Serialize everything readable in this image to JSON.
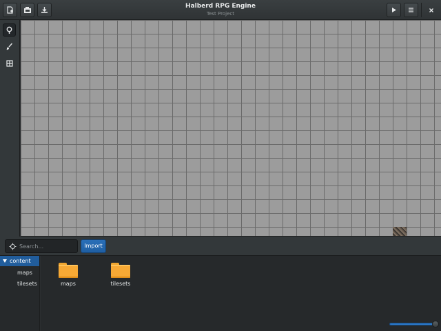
{
  "header": {
    "title": "Halberd RPG Engine",
    "subtitle": "Test Project",
    "left_buttons": [
      {
        "icon": "new-document-icon"
      },
      {
        "icon": "open-icon"
      },
      {
        "icon": "download-icon"
      }
    ],
    "right_buttons": [
      {
        "icon": "play-icon"
      },
      {
        "icon": "menu-icon"
      },
      {
        "icon": "close-icon"
      }
    ]
  },
  "tools": [
    {
      "icon": "pin-icon",
      "active": true
    },
    {
      "icon": "brush-icon",
      "active": false
    },
    {
      "icon": "grid-select-icon",
      "active": false
    }
  ],
  "canvas": {
    "background": "#9c9c9c",
    "grid_color": "#6a6a6a"
  },
  "panel": {
    "search_placeholder": "Search...",
    "import_label": "Import",
    "accent": "#2a6fb8"
  },
  "tree": {
    "root": "content",
    "children": [
      "maps",
      "tilesets"
    ]
  },
  "files": [
    {
      "name": "maps",
      "icon": "folder-icon"
    },
    {
      "name": "tilesets",
      "icon": "folder-icon"
    }
  ],
  "zoom": {
    "value": 1.0
  }
}
